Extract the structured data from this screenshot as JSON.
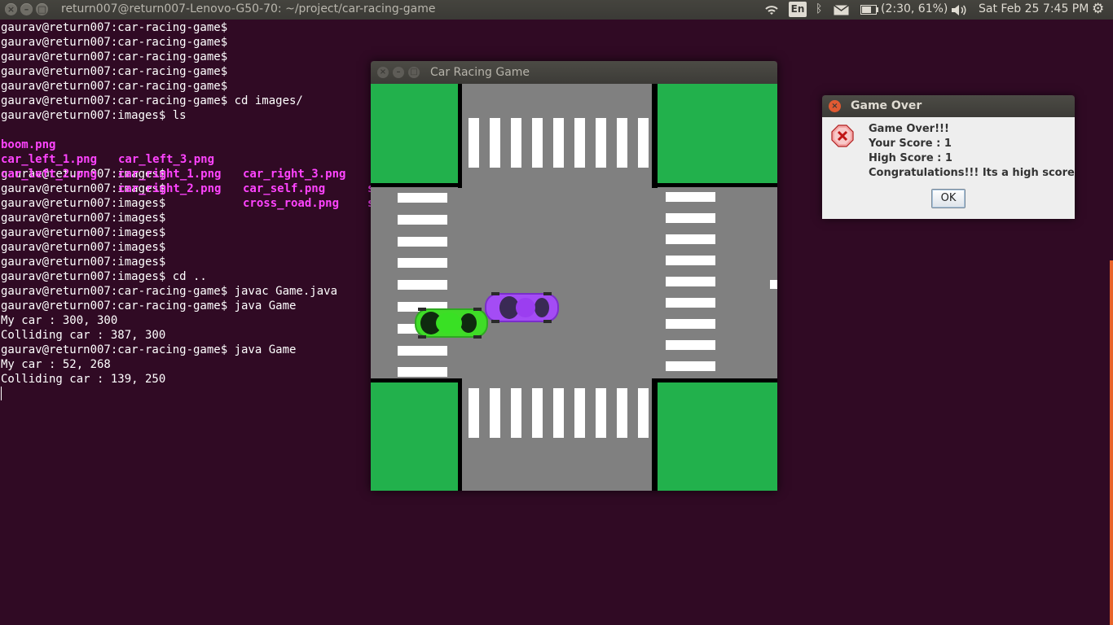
{
  "topbar": {
    "window_title": "return007@return007-Lenovo-G50-70: ~/project/car-racing-game",
    "keyboard": "En",
    "battery": "(2:30, 61%)",
    "datetime": "Sat Feb 25  7:45 PM",
    "icons": [
      "wifi-icon",
      "keyboard-icon",
      "bluetooth-icon",
      "mail-icon",
      "battery-icon",
      "volume-icon",
      "settings-gear-icon"
    ]
  },
  "terminal": {
    "lines": [
      "gaurav@return007:car-racing-game$",
      "gaurav@return007:car-racing-game$",
      "gaurav@return007:car-racing-game$",
      "gaurav@return007:car-racing-game$",
      "gaurav@return007:car-racing-game$",
      "gaurav@return007:car-racing-game$ cd images/",
      "gaurav@return007:images$ ls",
      "",
      "",
      "",
      "gaurav@return007:images$",
      "gaurav@return007:images$",
      "gaurav@return007:images$",
      "gaurav@return007:images$",
      "gaurav@return007:images$",
      "gaurav@return007:images$",
      "gaurav@return007:images$",
      "gaurav@return007:images$ cd ..",
      "gaurav@return007:car-racing-game$ javac Game.java",
      "gaurav@return007:car-racing-game$ java Game",
      "My car : 300, 300",
      "Colliding car : 387, 300",
      "gaurav@return007:car-racing-game$ java Game",
      "My car : 52, 268",
      "Colliding car : 139, 250"
    ],
    "ls_files": [
      [
        "boom.png",
        "car_left_3.png",
        "car_right_3.png",
        "s"
      ],
      [
        "car_left_1.png",
        "car_right_1.png",
        "car_self.png",
        "s"
      ],
      [
        "car_left_2.png",
        "car_right_2.png",
        "cross_road.png",
        ""
      ]
    ]
  },
  "game": {
    "title": "Car Racing Game",
    "colors": {
      "road": "#808080",
      "grass": "#22b14c",
      "my_car": "#33cc1f",
      "other_car": "#9b3ef0"
    }
  },
  "dialog": {
    "title": "Game Over",
    "line1": "Game Over!!!",
    "line2": "Your Score : 1",
    "line3": "High Score : 1",
    "line4": "Congratulations!!! Its a high score",
    "ok_label": "OK"
  }
}
